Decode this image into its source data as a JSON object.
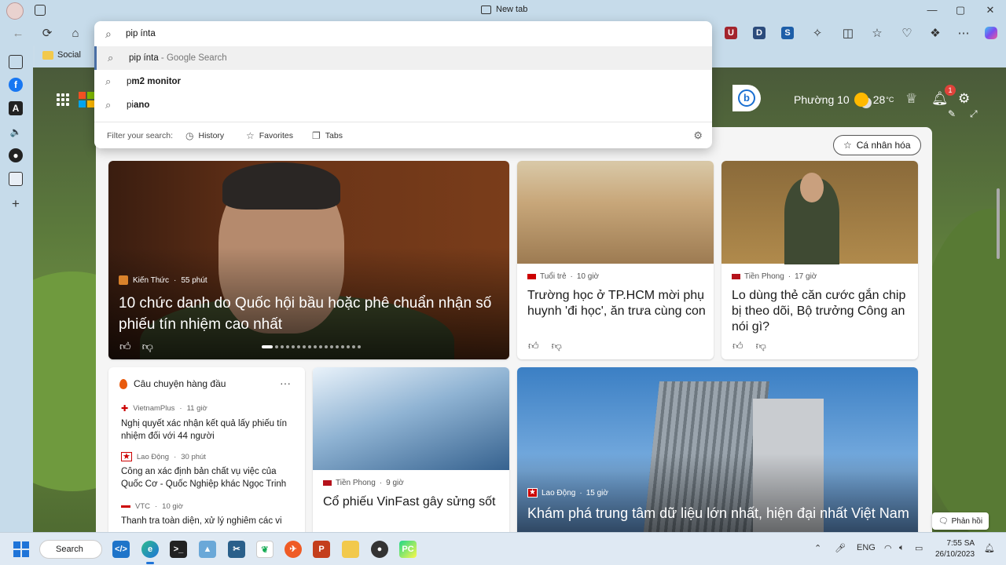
{
  "window": {
    "tab_title": "New tab",
    "minimize": "—",
    "maximize": "▢",
    "close": "✕"
  },
  "favorites": {
    "social_label": "Social"
  },
  "address": {
    "value": "pip ínta",
    "suggestions": [
      {
        "bold_prefix": "",
        "text": "pip ínta",
        "suffix": " - Google Search"
      },
      {
        "plain": "p",
        "bold": "m2 monitor"
      },
      {
        "plain": "pi",
        "bold": "ano"
      }
    ],
    "filter_label": "Filter your search:",
    "filters": [
      "History",
      "Favorites",
      "Tabs"
    ]
  },
  "header": {
    "location": "Phường 10",
    "temperature": "28",
    "temp_unit": "°C",
    "notification_count": "1"
  },
  "feed": {
    "personalize_label": "Cá nhân hóa",
    "hero": {
      "source": "Kiến Thức",
      "age": "55 phút",
      "title": "10 chức danh do Quốc hội bầu hoặc phê chuẩn nhận số phiếu tín nhiệm cao nhất"
    },
    "card_school": {
      "source": "Tuổi trẻ",
      "age": "10 giờ",
      "title": "Trường học ở TP.HCM mời phụ huynh 'đi học', ăn trưa cùng con"
    },
    "card_minister": {
      "source": "Tiền Phong",
      "age": "17 giờ",
      "title": "Lo dùng thẻ căn cước gắn chip bị theo dõi, Bộ trưởng Công an nói gì?"
    },
    "top_stories": {
      "heading": "Câu chuyện hàng đầu",
      "more": "···",
      "items": [
        {
          "source": "VietnamPlus",
          "age": "11 giờ",
          "title": "Nghị quyết xác nhận kết quả lấy phiếu tín nhiệm đối với 44 người"
        },
        {
          "source": "Lao Động",
          "age": "30 phút",
          "title": "Công an xác định bản chất vụ việc của Quốc Cơ - Quốc Nghiệp khác Ngọc Trinh"
        },
        {
          "source": "VTC",
          "age": "10 giờ",
          "title": "Thanh tra toàn diện, xử lý nghiêm các vi"
        }
      ]
    },
    "card_vinfast": {
      "source": "Tiền Phong",
      "age": "9 giờ",
      "title": "Cổ phiếu VinFast gây sửng sốt"
    },
    "card_datacenter": {
      "source": "Lao Động",
      "age": "15 giờ",
      "title": "Khám phá trung tâm dữ liệu lớn nhất, hiện đại nhất Việt Nam"
    },
    "feedback_label": "Phản hồi"
  },
  "taskbar": {
    "search_label": "Search",
    "lang": "ENG",
    "time": "7:55 SA",
    "date": "26/10/2023"
  },
  "colors": {
    "accent": "#1f74d8",
    "chrome_bg": "#c6dbea",
    "badge": "#e0433a"
  }
}
